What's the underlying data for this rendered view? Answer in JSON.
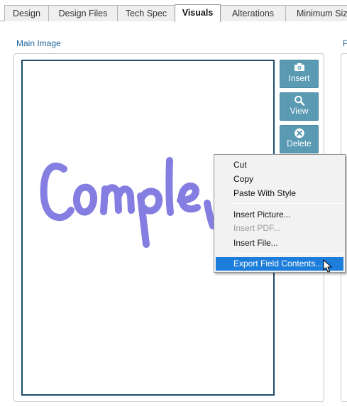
{
  "tabs": [
    {
      "label": "Design",
      "active": false
    },
    {
      "label": "Design Files",
      "active": false
    },
    {
      "label": "Tech Spec",
      "active": false
    },
    {
      "label": "Visuals",
      "active": true
    },
    {
      "label": "Alterations",
      "active": false
    },
    {
      "label": "Minimum Sizes",
      "active": false
    }
  ],
  "main": {
    "section_label": "Main Image",
    "right_section_label_partial": "P",
    "image_handwriting": "Comple"
  },
  "side_buttons": [
    {
      "label": "Insert",
      "icon": "camera-icon"
    },
    {
      "label": "View",
      "icon": "magnifier-icon"
    },
    {
      "label": "Delete",
      "icon": "close-circle-icon"
    }
  ],
  "context_menu": {
    "items": [
      {
        "label": "Cut",
        "enabled": true
      },
      {
        "label": "Copy",
        "enabled": true
      },
      {
        "label": "Paste With Style",
        "enabled": true
      },
      {
        "label": "Insert Picture...",
        "enabled": true
      },
      {
        "label": "Insert PDF...",
        "enabled": false
      },
      {
        "label": "Insert File...",
        "enabled": true
      },
      {
        "label": "Export Field Contents...",
        "enabled": true,
        "highlighted": true
      }
    ]
  },
  "colors": {
    "button_bg": "#5a9ab3",
    "label_blue": "#1e6497",
    "frame_border": "#1f4d6e",
    "menu_highlight": "#1c7ddb",
    "handwriting": "#7b74e0"
  }
}
